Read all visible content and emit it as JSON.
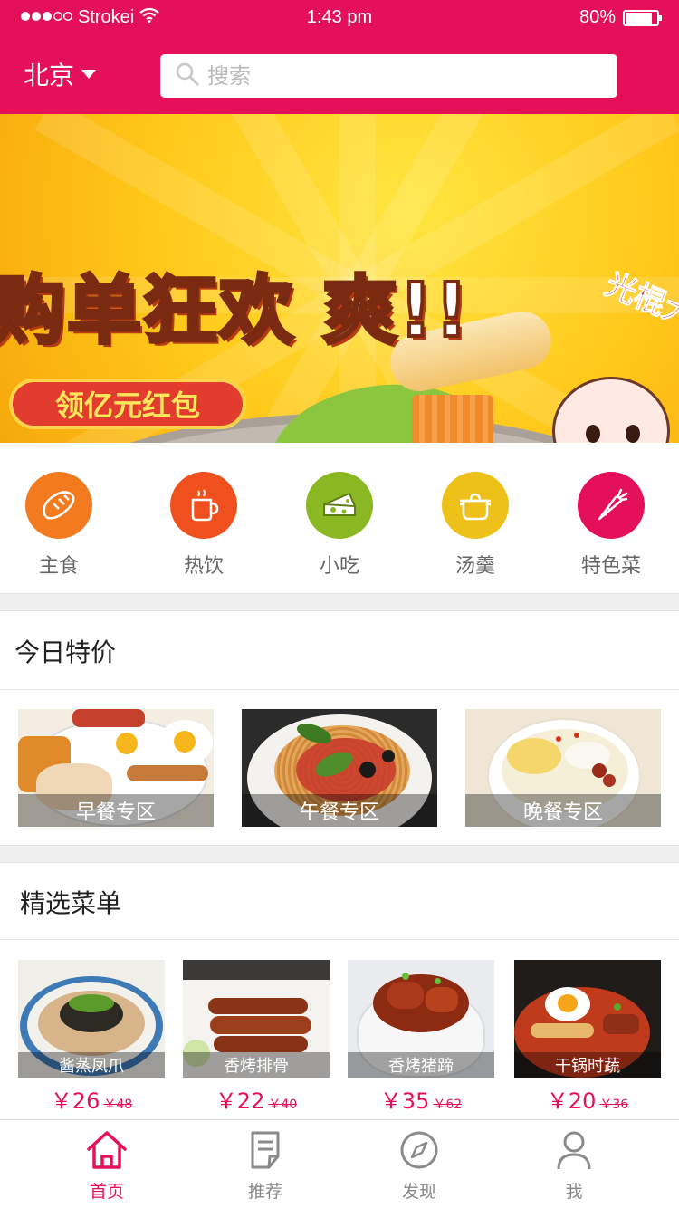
{
  "status_bar": {
    "carrier": "Strokei",
    "time": "1:43 pm",
    "battery": "80%",
    "battery_level": 0.8
  },
  "header": {
    "city": "北京",
    "search_placeholder": "搜索"
  },
  "banner": {
    "title": "购单狂欢 爽!!",
    "subtitle": "领亿元红包",
    "corner_text": "光棍大",
    "slide_count": 4,
    "active_slide": 0
  },
  "categories": [
    {
      "label": "主食",
      "icon": "bread-icon",
      "color": "#f47a20"
    },
    {
      "label": "热饮",
      "icon": "coffee-cup-icon",
      "color": "#f0501e"
    },
    {
      "label": "小吃",
      "icon": "cheese-icon",
      "color": "#8ab822"
    },
    {
      "label": "汤羹",
      "icon": "pot-icon",
      "color": "#eec01a"
    },
    {
      "label": "特色菜",
      "icon": "carrot-icon",
      "color": "#e4115a"
    }
  ],
  "today_special": {
    "title": "今日特价",
    "items": [
      {
        "label": "早餐专区"
      },
      {
        "label": "午餐专区"
      },
      {
        "label": "晚餐专区"
      }
    ]
  },
  "featured_menu": {
    "title": "精选菜单",
    "items": [
      {
        "name": "酱蒸凤爪",
        "price": "￥26",
        "old_price": "￥48"
      },
      {
        "name": "香烤排骨",
        "price": "￥22",
        "old_price": "￥40"
      },
      {
        "name": "香烤猪蹄",
        "price": "￥35",
        "old_price": "￥62"
      },
      {
        "name": "干锅时蔬",
        "price": "￥20",
        "old_price": "￥36"
      }
    ]
  },
  "tabbar": {
    "items": [
      {
        "label": "首页",
        "icon": "home-icon",
        "active": true
      },
      {
        "label": "推荐",
        "icon": "note-icon",
        "active": false
      },
      {
        "label": "发现",
        "icon": "compass-icon",
        "active": false
      },
      {
        "label": "我",
        "icon": "user-icon",
        "active": false
      }
    ]
  },
  "colors": {
    "brand": "#e4115a",
    "separator": "#efefef"
  }
}
